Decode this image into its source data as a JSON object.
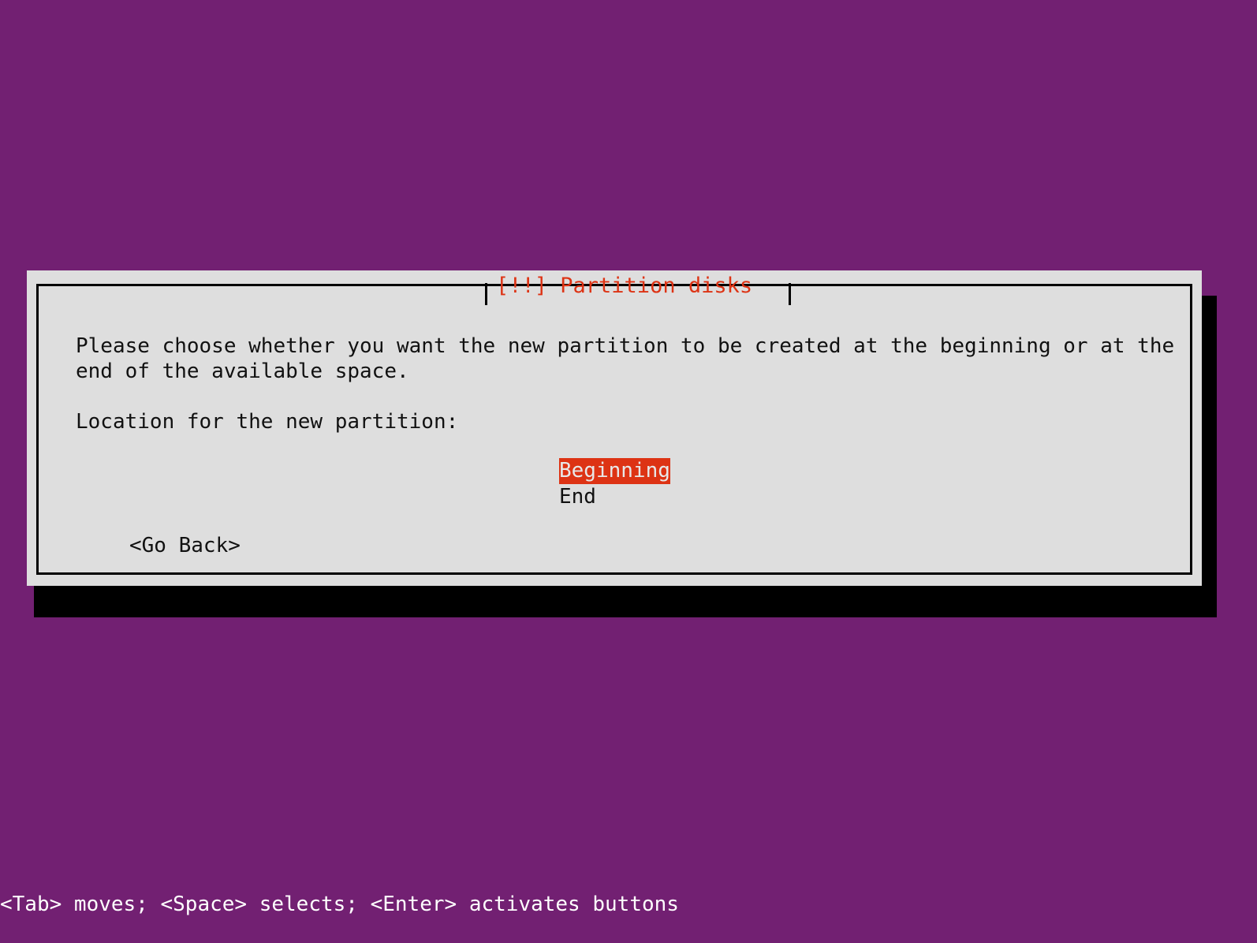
{
  "screen": {
    "background_color": "#722072",
    "text_color": "#ffffff"
  },
  "dialog": {
    "title": "[!!] Partition disks",
    "title_color": "#dd3314",
    "background_color": "#dedede",
    "border_color": "#000000",
    "intro_line1": "Please choose whether you want the new partition to be created at the beginning or at the",
    "intro_line2": "end of the available space.",
    "prompt": "Location for the new partition:",
    "choices": [
      {
        "label": "Beginning",
        "selected": true
      },
      {
        "label": "End",
        "selected": false
      }
    ],
    "highlight_color": "#dd3314",
    "highlight_text_color": "#e8e8e8",
    "buttons": [
      {
        "label": "<Go Back>"
      }
    ]
  },
  "status_bar": {
    "text": "<Tab> moves; <Space> selects; <Enter> activates buttons"
  }
}
